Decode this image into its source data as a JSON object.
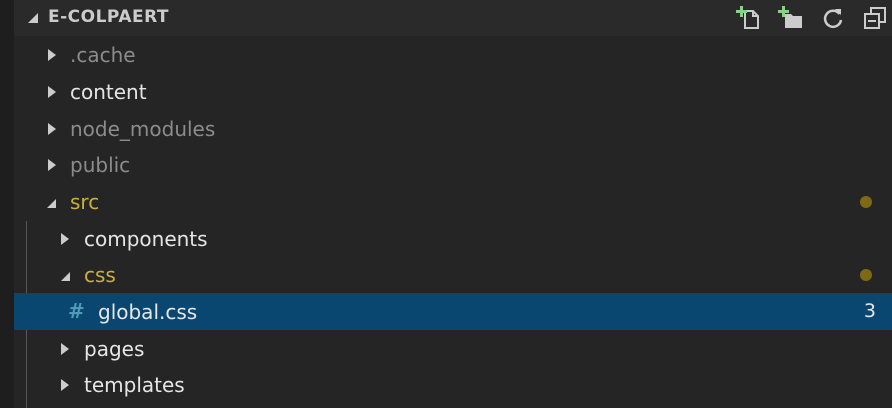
{
  "header": {
    "title": "E-COLPAERT",
    "actions": [
      {
        "name": "new-file",
        "icon": "new-file-icon"
      },
      {
        "name": "new-folder",
        "icon": "new-folder-icon"
      },
      {
        "name": "refresh",
        "icon": "refresh-icon"
      },
      {
        "name": "collapse-all",
        "icon": "collapse-all-icon"
      }
    ]
  },
  "tree": {
    "items": [
      {
        "label": ".cache",
        "type": "folder",
        "expanded": false,
        "status": "ignored"
      },
      {
        "label": "content",
        "type": "folder",
        "expanded": false,
        "status": "normal"
      },
      {
        "label": "node_modules",
        "type": "folder",
        "expanded": false,
        "status": "ignored"
      },
      {
        "label": "public",
        "type": "folder",
        "expanded": false,
        "status": "ignored"
      },
      {
        "label": "src",
        "type": "folder",
        "expanded": true,
        "status": "modified"
      },
      {
        "label": "components",
        "type": "folder",
        "expanded": false,
        "status": "normal"
      },
      {
        "label": "css",
        "type": "folder",
        "expanded": true,
        "status": "modified"
      },
      {
        "label": "global.css",
        "type": "file",
        "icon": "hash-icon",
        "icon_glyph": "#",
        "status": "problems",
        "badge": "3",
        "selected": true
      },
      {
        "label": "pages",
        "type": "folder",
        "expanded": false,
        "status": "normal"
      },
      {
        "label": "templates",
        "type": "folder",
        "expanded": false,
        "status": "normal"
      }
    ]
  },
  "colors": {
    "background": "#252526",
    "header_background": "#2a2a2b",
    "selection": "#094771",
    "modified_text": "#cbb13a",
    "modified_dot": "#7e6a14",
    "ignored_text": "#8c8c8c",
    "css_icon": "#519aba",
    "action_plus": "#89d185"
  }
}
